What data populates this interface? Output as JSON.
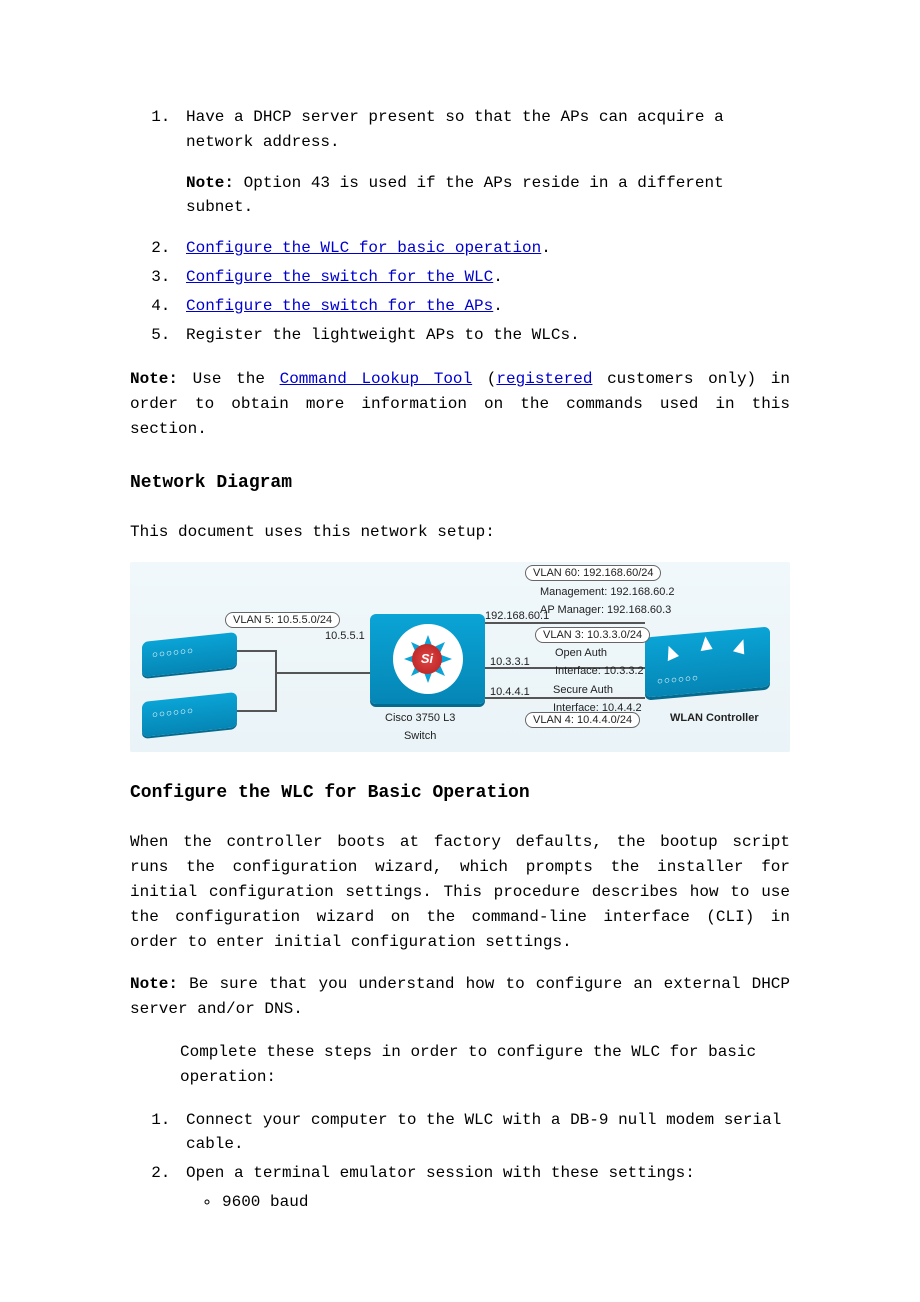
{
  "steps_top": {
    "item1": "Have a DHCP server present so that the APs can acquire a network address.",
    "note1_label": "Note:",
    "note1_text": "  Option 43 is used if the APs reside in a different subnet.",
    "link2": "Configure the WLC for basic operation",
    "link3": "Configure the switch for the WLC",
    "link4": "Configure the switch for the APs",
    "item5": "Register the lightweight APs to the WLCs."
  },
  "note_lookup": {
    "label": "Note:",
    "pre": "  Use the ",
    "link1": "Command Lookup Tool",
    "mid": " (",
    "link2": "registered",
    "post": " customers only) in order to obtain more information on the commands used in this section."
  },
  "section_diagram": {
    "heading": "Network Diagram",
    "intro": "This document uses this network setup:"
  },
  "diagram": {
    "vlan5_pill": "VLAN 5: 10.5.5.0/24",
    "ip_10551": "10.5.5.1",
    "switch_label": "Cisco 3750 L3",
    "switch_label2": "Switch",
    "vlan60_pill": "VLAN 60: 192.168.60/24",
    "mgmt1": "Management: 192.168.60.2",
    "mgmt2": "AP Manager: 192.168.60.3",
    "ip_19216860_1": "192.168.60.1",
    "vlan3_pill": "VLAN 3: 10.3.3.0/24",
    "open_auth1": "Open Auth",
    "open_auth2": "Interface: 10.3.3.2",
    "ip_10331": "10.3.3.1",
    "ip_10441": "10.4.4.1",
    "secure_auth1": "Secure Auth",
    "secure_auth2": "Interface: 10.4.4.2",
    "vlan4_pill": "VLAN 4: 10.4.4.0/24",
    "wlan_label": "WLAN Controller",
    "si_badge": "Si"
  },
  "section_wlc": {
    "heading": "Configure the WLC for Basic Operation",
    "para1": "When the controller boots at factory defaults, the bootup script runs the configuration wizard, which prompts the installer for initial configuration settings. This procedure describes how to use the configuration wizard on the command-line interface (CLI) in order to enter initial configuration settings.",
    "note_label": "Note:",
    "note_text": "  Be sure that you understand how to configure an external DHCP server and/or DNS.",
    "para2": "Complete these steps in order to configure the WLC for basic operation:",
    "step1": "Connect your computer to the WLC with a DB-9 null modem serial cable.",
    "step2": "Open a terminal emulator session with these settings:",
    "setting1": "9600 baud"
  }
}
